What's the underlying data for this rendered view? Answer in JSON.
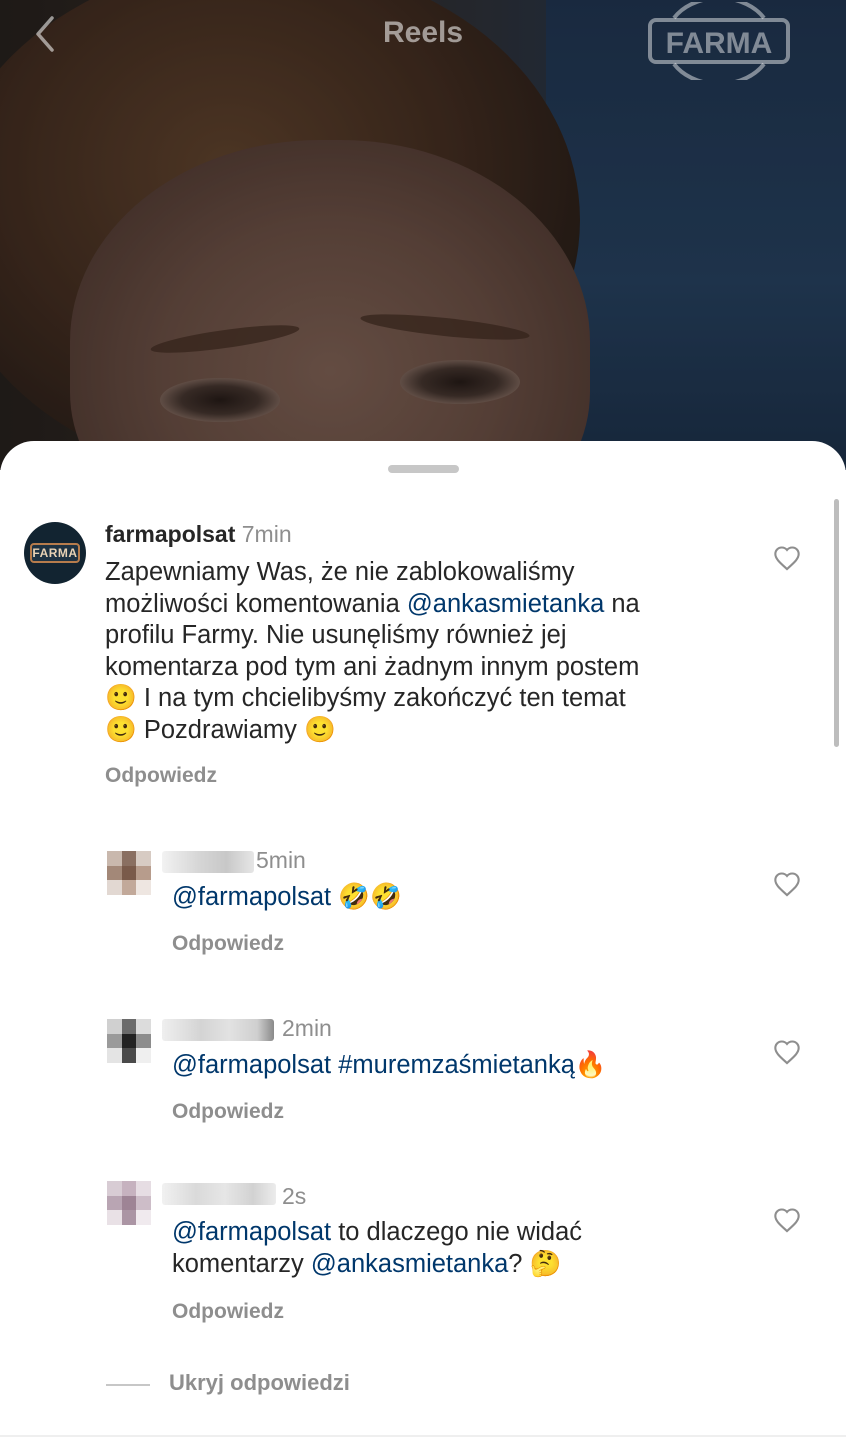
{
  "header": {
    "title": "Reels",
    "logo_text": "FARMA"
  },
  "colors": {
    "mention": "#00376b",
    "secondary_text": "#8e8e8e"
  },
  "comments": [
    {
      "username": "farmapolsat",
      "time": "7min",
      "avatar_text": "FARMA",
      "lines": [
        {
          "text": "Zapewniamy Was, że nie zablokowaliśmy"
        },
        {
          "pre": "możliwości komentowania ",
          "mention": "@ankasmietanka",
          "post": " na"
        },
        {
          "text": "profilu Farmy. Nie usunęliśmy również jej"
        },
        {
          "text": "komentarza pod tym ani żadnym innym postem"
        },
        {
          "emoji1": "🙂",
          "text": " I na tym chcielibyśmy zakończyć ten temat"
        },
        {
          "emoji1": "🙂",
          "text": " Pozdrawiamy ",
          "emoji2": "🙂"
        }
      ],
      "reply_label": "Odpowiedz",
      "like_icon": "heart-outline-icon"
    },
    {
      "time": "5min",
      "mention": "@farmapolsat",
      "emojis": "🤣🤣",
      "reply_label": "Odpowiedz",
      "like_icon": "heart-outline-icon"
    },
    {
      "time": "2min",
      "mention": "@farmapolsat",
      "hashtag": "#muremzaśmietanką",
      "emoji": "🔥",
      "reply_label": "Odpowiedz",
      "like_icon": "heart-outline-icon"
    },
    {
      "time": "2s",
      "line1_mention": "@farmapolsat",
      "line1_text": " to dlaczego nie widać",
      "line2_text": "komentarzy ",
      "line2_mention": "@ankasmietanka",
      "line2_post": "?",
      "emoji": "🤔",
      "reply_label": "Odpowiedz",
      "like_icon": "heart-outline-icon"
    }
  ],
  "hide_replies_label": "Ukryj odpowiedzi"
}
